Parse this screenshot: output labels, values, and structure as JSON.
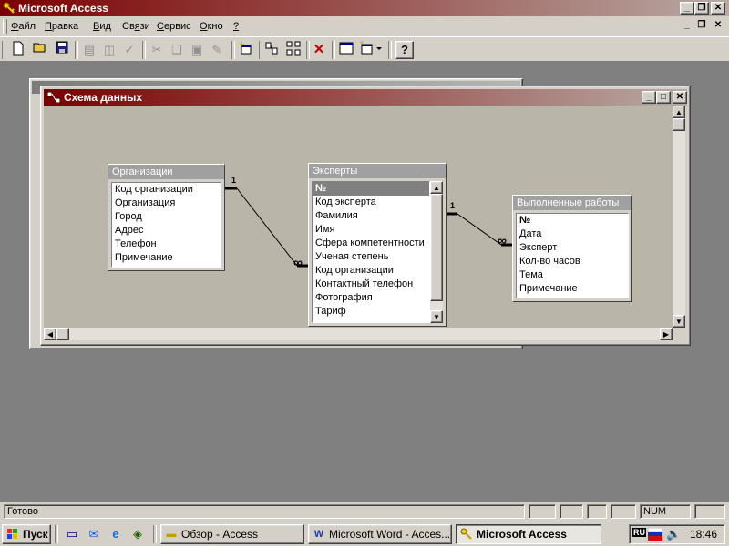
{
  "app": {
    "title": "Microsoft Access",
    "caption_buttons": {
      "minimize": "_",
      "restore": "❐",
      "close": "✕"
    }
  },
  "menu": [
    {
      "label": "Файл",
      "mnemonic_index": 0
    },
    {
      "label": "Правка",
      "mnemonic_index": 0
    },
    {
      "label": "Вид",
      "mnemonic_index": 0
    },
    {
      "label": "Связи",
      "mnemonic_index": 2
    },
    {
      "label": "Сервис",
      "mnemonic_index": 0
    },
    {
      "label": "Окно",
      "mnemonic_index": 0
    },
    {
      "label": "?",
      "mnemonic_index": 0
    }
  ],
  "toolbar": {
    "icons": [
      "new-icon",
      "open-icon",
      "save-icon",
      "print-icon",
      "print-preview-icon",
      "spelling-icon",
      "cut-icon",
      "copy-icon",
      "paste-icon",
      "format-painter-icon",
      "show-table-icon",
      "show-direct-icon",
      "show-all-icon",
      "delete-icon",
      "database-window-icon",
      "new-object-icon",
      "help-icon"
    ]
  },
  "relationships_window": {
    "title": "Схема данных",
    "tables": [
      {
        "name": "Организации",
        "fields": [
          "Код организации",
          "Организация",
          "Город",
          "Адрес",
          "Телефон",
          "Примечание"
        ]
      },
      {
        "name": "Эксперты",
        "fields": [
          "№",
          "Код эксперта",
          "Фамилия",
          "Имя",
          "Сфера компетентности",
          "Ученая степень",
          "Код организации",
          "Контактный телефон",
          "Фотография",
          "Тариф"
        ]
      },
      {
        "name": "Выполненные работы",
        "fields": [
          "№",
          "Дата",
          "Эксперт",
          "Кол-во часов",
          "Тема",
          "Примечание"
        ]
      }
    ],
    "relations": [
      {
        "from": "Организации",
        "to": "Эксперты",
        "one": "1",
        "many": "∞"
      },
      {
        "from": "Эксперты",
        "to": "Выполненные работы",
        "one": "1",
        "many": "∞"
      }
    ]
  },
  "status": {
    "text": "Готово",
    "num": "NUM"
  },
  "taskbar": {
    "start": "Пуск",
    "buttons": [
      {
        "label": "Обзор - Access",
        "icon": "folder-icon",
        "active": false
      },
      {
        "label": "Microsoft Word - Acces...",
        "icon": "word-icon",
        "active": false
      },
      {
        "label": "Microsoft Access",
        "icon": "access-key-icon",
        "active": true
      }
    ],
    "clock": "18:46",
    "lang": "RU"
  }
}
